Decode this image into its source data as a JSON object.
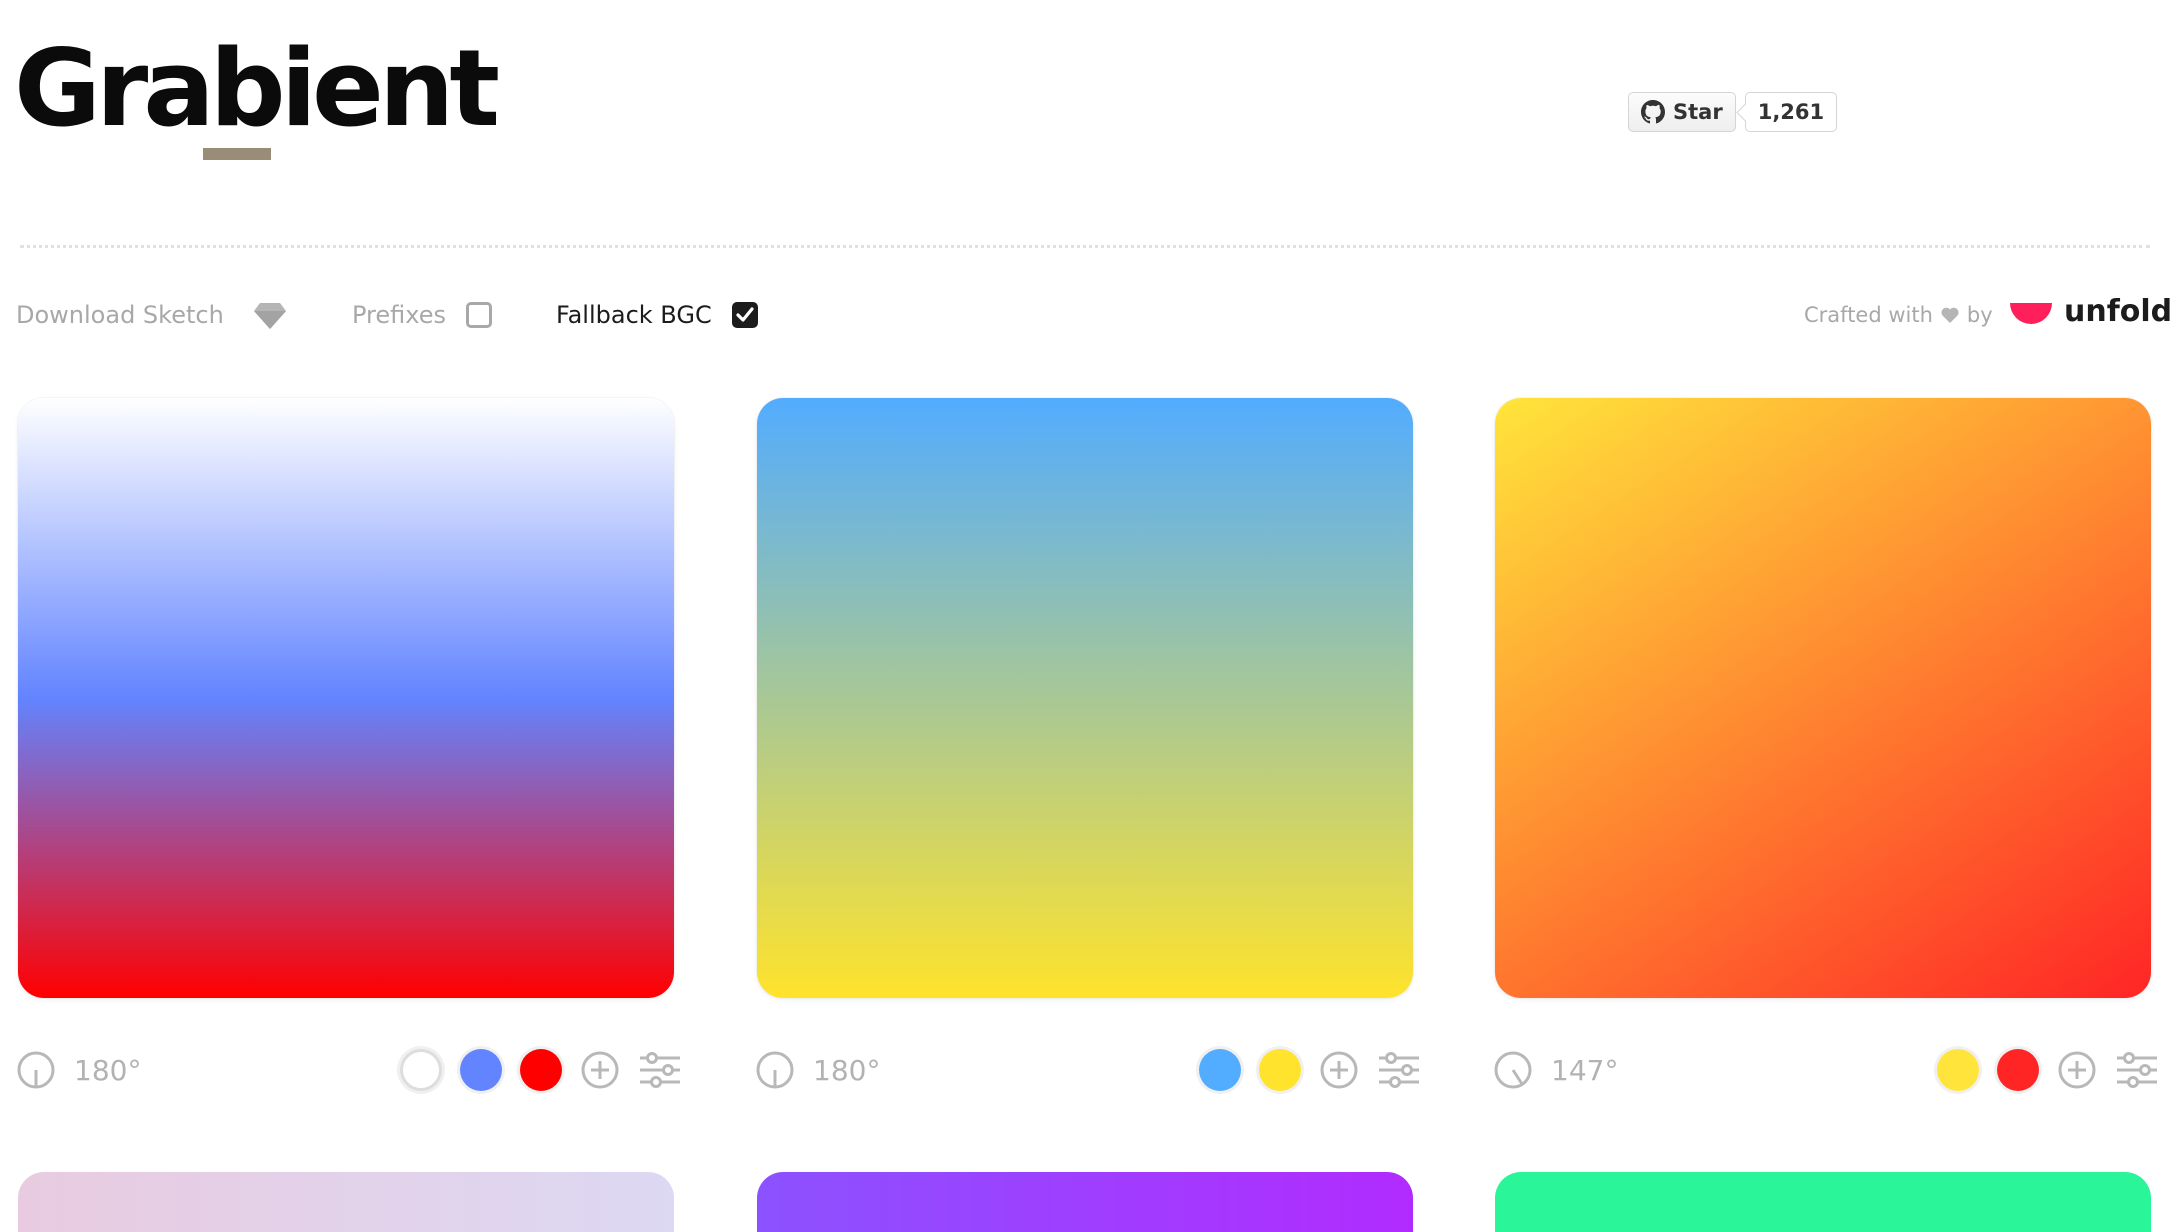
{
  "header": {
    "logo": "Grabient",
    "github": {
      "star_label": "Star",
      "count": "1,261"
    }
  },
  "toolbar": {
    "download_label": "Download Sketch",
    "prefixes_label": "Prefixes",
    "prefixes_checked": false,
    "fallback_label": "Fallback BGC",
    "fallback_checked": true,
    "crafted_prefix": "Crafted with",
    "crafted_suffix": "by",
    "brand": "unfold"
  },
  "gradients": [
    {
      "angle": "180°",
      "angle_deg": 180,
      "stops": [
        "#ffffff",
        "#6284ff",
        "#ff0000"
      ]
    },
    {
      "angle": "180°",
      "angle_deg": 180,
      "stops": [
        "#52acff",
        "#ffe32c"
      ]
    },
    {
      "angle": "147°",
      "angle_deg": 147,
      "stops": [
        "#ffe53b",
        "#ff2525"
      ]
    }
  ],
  "next_row": [
    {
      "stops": [
        "#e8cbe0",
        "#ddd8f3"
      ]
    },
    {
      "stops": [
        "#8c52ff",
        "#b12bff"
      ]
    },
    {
      "stops": [
        "#2af598",
        "#2af598"
      ]
    }
  ],
  "colors": {
    "accent_brand": "#ff1f5a",
    "muted_text": "#a8a8a8"
  }
}
